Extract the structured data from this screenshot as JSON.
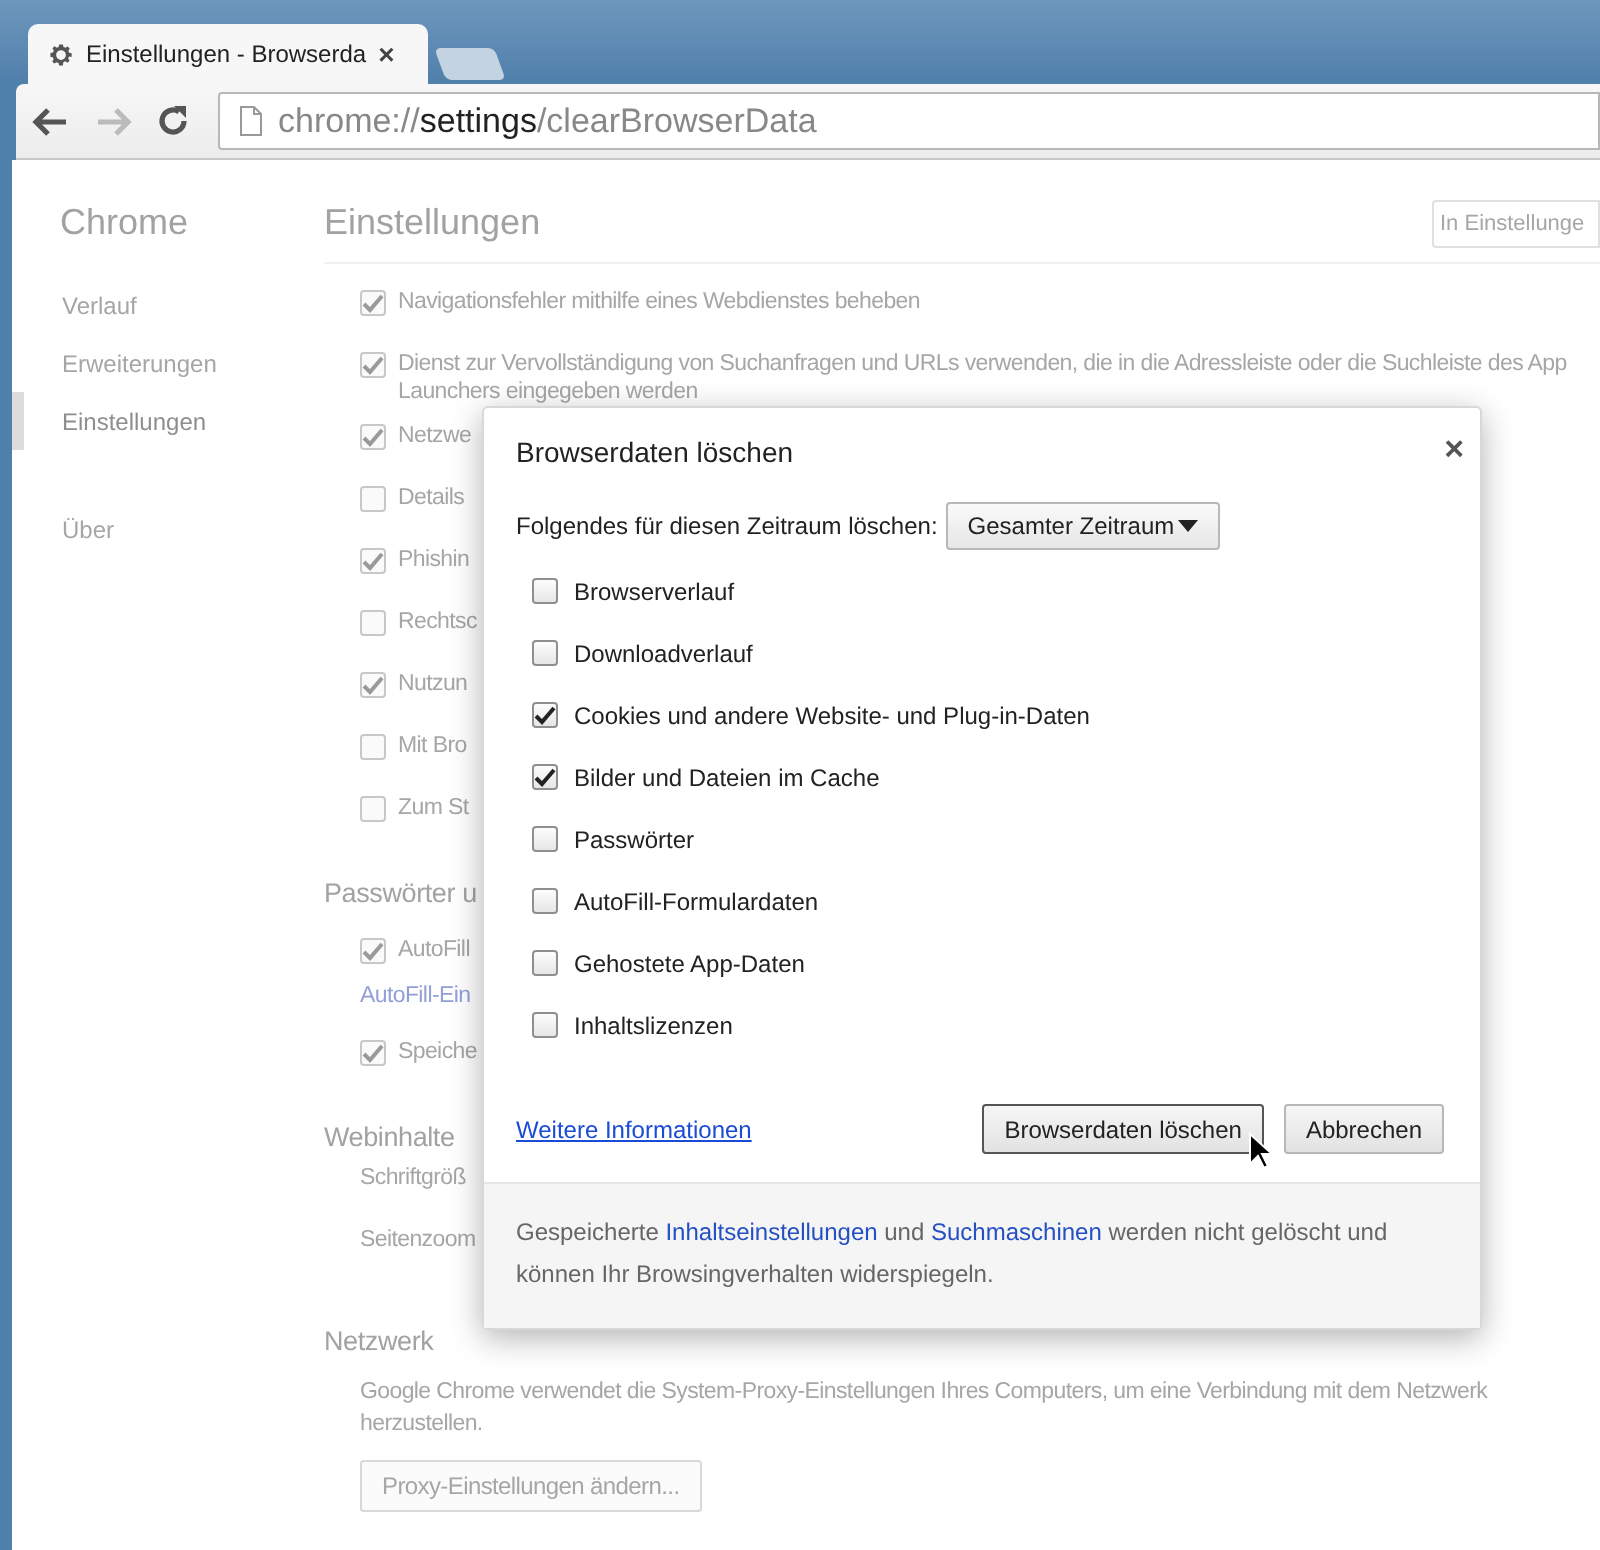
{
  "tab": {
    "title": "Einstellungen - Browserda",
    "close": "×"
  },
  "toolbar": {
    "forward_enabled": false,
    "url": {
      "scheme": "chrome://",
      "host": "settings",
      "path": "/clearBrowserData"
    }
  },
  "sidebar": {
    "title": "Chrome",
    "items": [
      {
        "label": "Verlauf",
        "selected": false
      },
      {
        "label": "Erweiterungen",
        "selected": false
      },
      {
        "label": "Einstellungen",
        "selected": true
      },
      {
        "label": "Über",
        "selected": false
      }
    ]
  },
  "settings": {
    "title": "Einstellungen",
    "search_placeholder": "In Einstellunge",
    "sections": [
      {
        "items": [
          {
            "kind": "checkbox",
            "label": "Navigationsfehler mithilfe eines Webdienstes beheben",
            "checked": true
          },
          {
            "kind": "checkbox",
            "label": "Dienst zur Vervollständigung von Suchanfragen und URLs verwenden, die in die Adressleiste oder die Suchleiste des App Launchers eingegeben werden",
            "checked": true
          },
          {
            "kind": "checkbox",
            "label": "Netzwe",
            "checked": true
          },
          {
            "kind": "checkbox",
            "label": "Details",
            "checked": false
          },
          {
            "kind": "checkbox",
            "label": "Phishin",
            "checked": true
          },
          {
            "kind": "checkbox",
            "label": "Rechtsc",
            "checked": false
          },
          {
            "kind": "checkbox",
            "label": "Nutzun",
            "checked": true
          },
          {
            "kind": "checkbox",
            "label": "Mit Bro",
            "checked": false
          },
          {
            "kind": "checkbox",
            "label": "Zum St",
            "checked": false
          }
        ]
      },
      {
        "title": "Passwörter u",
        "items": [
          {
            "kind": "checkbox",
            "label": "AutoFill",
            "checked": true
          },
          {
            "kind": "link",
            "label": "AutoFill-Ein"
          },
          {
            "kind": "checkbox",
            "label": "Speiche",
            "checked": true
          }
        ]
      },
      {
        "title": "Webinhalte",
        "items": [
          {
            "kind": "label",
            "label": "Schriftgröß"
          },
          {
            "kind": "label",
            "label": "Seitenzoom"
          }
        ]
      },
      {
        "title": "Netzwerk",
        "items": [
          {
            "kind": "paragraph",
            "label": "Google Chrome verwendet die System-Proxy-Einstellungen Ihres Computers, um eine Verbindung mit dem Netzwerk herzustellen."
          },
          {
            "kind": "button",
            "label": "Proxy-Einstellungen ändern..."
          }
        ]
      }
    ]
  },
  "dialog": {
    "title": "Browserdaten löschen",
    "close": "×",
    "range_label": "Folgendes für diesen Zeitraum löschen:",
    "range_value": "Gesamter Zeitraum",
    "options": [
      {
        "label": "Browserverlauf",
        "checked": false
      },
      {
        "label": "Downloadverlauf",
        "checked": false
      },
      {
        "label": "Cookies und andere Website- und Plug-in-Daten",
        "checked": true
      },
      {
        "label": "Bilder und Dateien im Cache",
        "checked": true
      },
      {
        "label": "Passwörter",
        "checked": false
      },
      {
        "label": "AutoFill-Formulardaten",
        "checked": false
      },
      {
        "label": "Gehostete App-Daten",
        "checked": false
      },
      {
        "label": "Inhaltslizenzen",
        "checked": false
      }
    ],
    "more_info": "Weitere Informationen",
    "buttons": [
      {
        "label": "Browserdaten löschen",
        "focused": true
      },
      {
        "label": "Abbrechen",
        "focused": false
      }
    ],
    "footer": [
      {
        "text": "Gespeicherte ",
        "link": false
      },
      {
        "text": "Inhaltseinstellungen",
        "link": true
      },
      {
        "text": " und ",
        "link": false
      },
      {
        "text": "Suchmaschinen",
        "link": true
      },
      {
        "text": " werden nicht gelöscht und können Ihr Browsingverhalten widerspiegeln.",
        "link": false
      }
    ]
  }
}
